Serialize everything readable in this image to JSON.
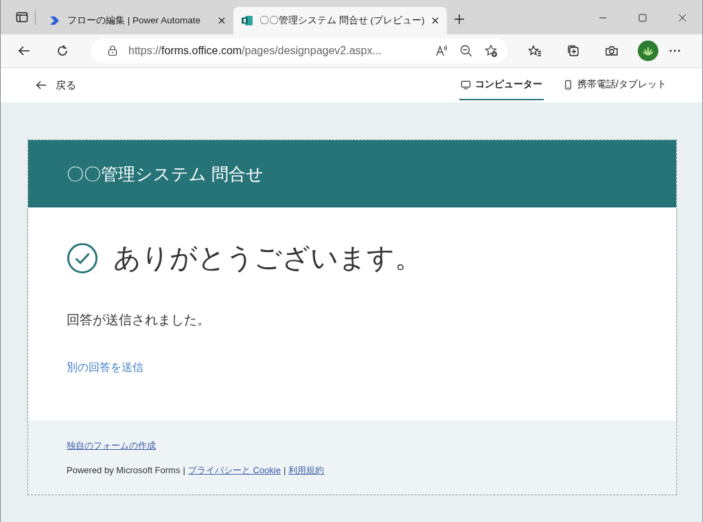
{
  "browser": {
    "tabs": [
      {
        "title": "フローの編集 | Power Automate",
        "selected": false
      },
      {
        "title": "〇〇管理システム 問合せ (プレビュー)",
        "selected": true
      }
    ],
    "url": {
      "scheme": "https://",
      "host": "forms.office.com",
      "path": "/pages/designpagev2.aspx..."
    }
  },
  "preview_bar": {
    "back": "戻る",
    "views": [
      {
        "label": "コンピューター",
        "kind": "desktop",
        "selected": true
      },
      {
        "label": "携帯電話/タブレット",
        "kind": "mobile",
        "selected": false
      }
    ]
  },
  "form": {
    "title": "〇〇管理システム 問合せ",
    "thanks": "ありがとうございます。",
    "message": "回答が送信されました。",
    "resubmit_link": "別の回答を送信",
    "footer": {
      "create_link": "独自のフォームの作成",
      "powered_by": "Powered by Microsoft Forms",
      "separator_1": "|",
      "privacy_link": "プライバシーと Cookie",
      "separator_2": "|",
      "terms_link": "利用規約"
    }
  }
}
